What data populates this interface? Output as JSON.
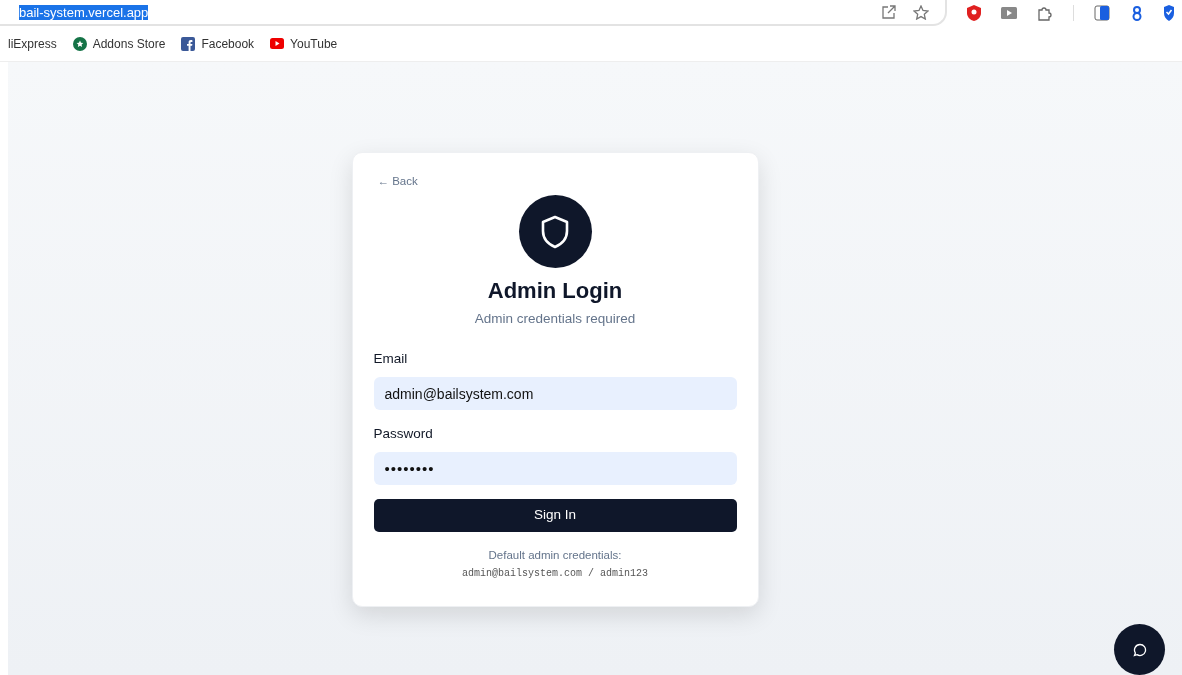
{
  "browser": {
    "url": "bail-system.vercel.app",
    "url_selected": true,
    "bookmarks": [
      {
        "label": "liExpress",
        "kind": "none"
      },
      {
        "label": "Addons Store",
        "kind": "addons"
      },
      {
        "label": "Facebook",
        "kind": "facebook"
      },
      {
        "label": "YouTube",
        "kind": "youtube"
      }
    ]
  },
  "login": {
    "back": "← Back",
    "title": "Admin Login",
    "subtitle": "Admin credentials required",
    "fields": [
      {
        "label": "Email",
        "value": "admin@bailsystem.com"
      },
      {
        "label": "Password",
        "value": "••••••••"
      }
    ],
    "submit": "Sign In",
    "hint": "Default admin credentials:",
    "credentials": "admin@bailsystem.com / admin123"
  }
}
